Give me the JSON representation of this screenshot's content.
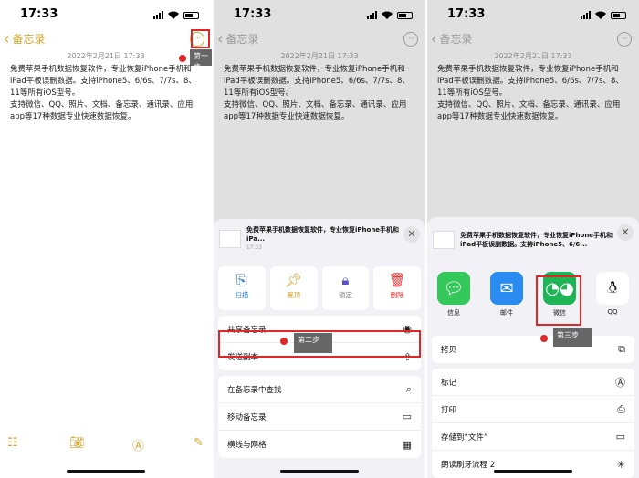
{
  "status": {
    "time": "17:33"
  },
  "nav": {
    "back_label": "备忘录",
    "back_icon": "chevron-left-icon",
    "more_icon": "ellipsis-circle-icon"
  },
  "note": {
    "date": "2022年2月21日 17:33",
    "lines": [
      "免费苹果手机数据恢复软件，专业恢复iPhone手机和iPad平板误删数据。支持iPhone5、6/6s、7/7s、8、11等所有iOS型号。",
      "支持微信、QQ、照片、文档、备忘录、通讯录、应用app等17种数据专业快速数据恢复。"
    ]
  },
  "steps": {
    "step1": "第一步",
    "step2": "第二步",
    "step3": "第三步"
  },
  "toolbar": {
    "items": [
      "checklist-icon",
      "camera-icon",
      "markup-icon",
      "compose-icon"
    ]
  },
  "sheet1": {
    "preview_title": "免费苹果手机数据恢复软件，专业恢复iPhone手机和iPa...",
    "preview_time": "17:33",
    "actions": [
      {
        "label": "扫描",
        "icon": "scan-doc-icon",
        "color": "#2f7fd1"
      },
      {
        "label": "置顶",
        "icon": "pin-icon",
        "color": "#d4a72c"
      },
      {
        "label": "锁定",
        "icon": "lock-icon",
        "color": "#5b4fc9"
      },
      {
        "label": "删除",
        "icon": "trash-icon",
        "color": "#e02626"
      }
    ],
    "group1": [
      {
        "label": "共享备忘录",
        "icon": "share-person-icon"
      },
      {
        "label": "发送副本",
        "icon": "share-icon"
      }
    ],
    "group2": [
      {
        "label": "在备忘录中查找",
        "icon": "search-icon"
      },
      {
        "label": "移动备忘录",
        "icon": "folder-icon"
      },
      {
        "label": "横线与网格",
        "icon": "grid-icon"
      }
    ]
  },
  "sheet2": {
    "preview_title": "免费苹果手机数据恢复软件，专业恢复iPhone手机和iPad平板误删数据。支持iPhone5、6/6...",
    "apps": [
      {
        "label": "信息",
        "icon": "messages-icon",
        "color": "#34c759"
      },
      {
        "label": "邮件",
        "icon": "mail-icon",
        "color": "#2a8cf0"
      },
      {
        "label": "微信",
        "icon": "wechat-icon",
        "color": "#1fb455"
      },
      {
        "label": "QQ",
        "icon": "qq-penguin-icon",
        "color": "#ffffff"
      }
    ],
    "group1": [
      {
        "label": "拷贝",
        "icon": "copy-icon"
      }
    ],
    "group2": [
      {
        "label": "标记",
        "icon": "markup-icon"
      },
      {
        "label": "打印",
        "icon": "printer-icon"
      },
      {
        "label": "存储到“文件”",
        "icon": "folder-icon"
      },
      {
        "label": "朗读刷牙流程 2",
        "icon": "sparkle-icon"
      }
    ]
  }
}
